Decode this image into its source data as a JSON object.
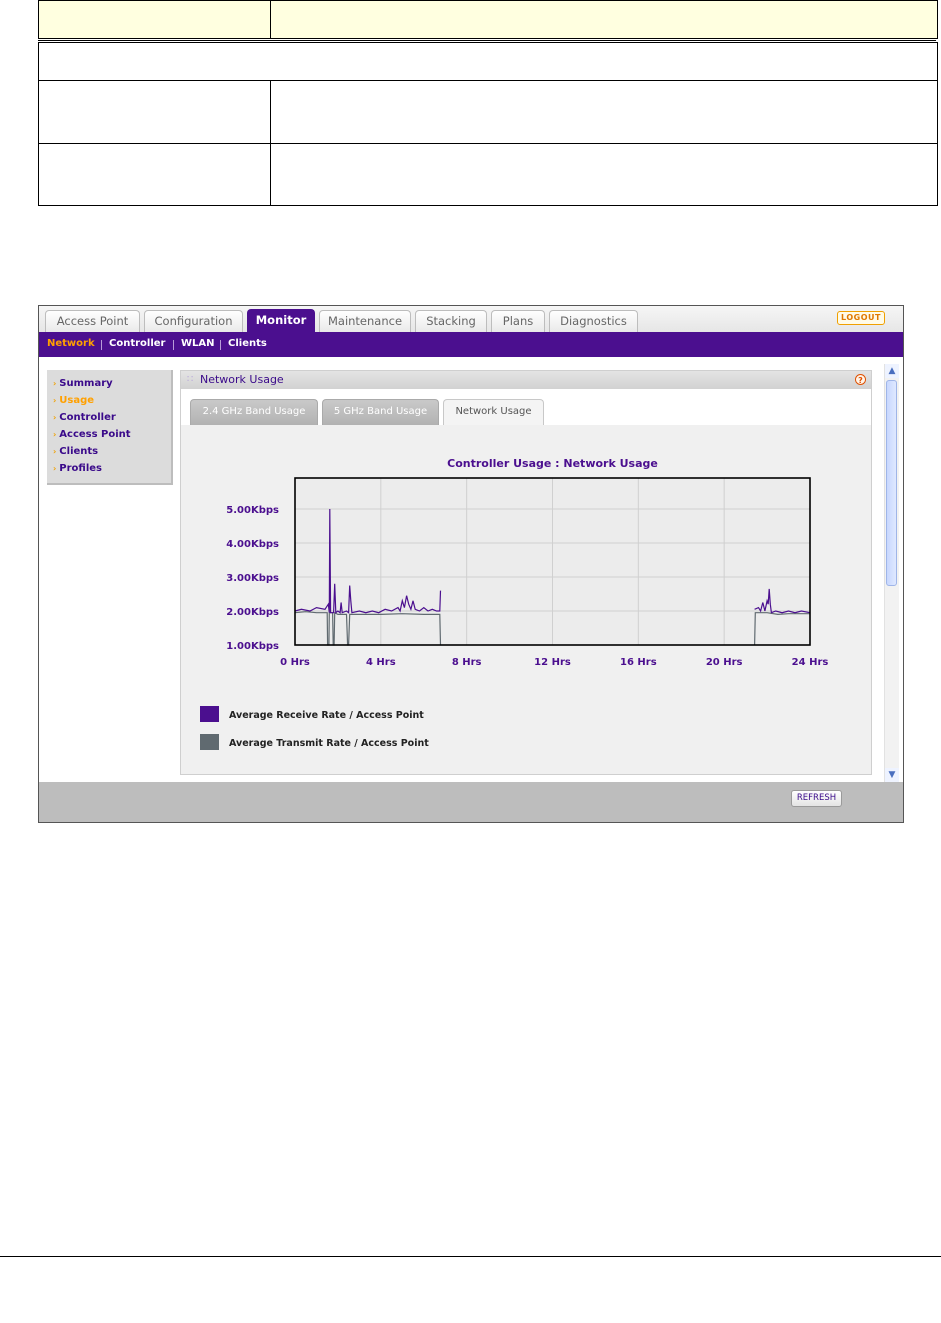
{
  "app": {
    "main_tabs": [
      {
        "label": "Access Point",
        "active": false
      },
      {
        "label": "Configuration",
        "active": false
      },
      {
        "label": "Monitor",
        "active": true
      },
      {
        "label": "Maintenance",
        "active": false
      },
      {
        "label": "Stacking",
        "active": false
      },
      {
        "label": "Plans",
        "active": false
      },
      {
        "label": "Diagnostics",
        "active": false
      }
    ],
    "logout_label": "LOGOUT",
    "sub_nav": [
      {
        "label": "Network",
        "active": true
      },
      {
        "label": "Controller",
        "active": false
      },
      {
        "label": "WLAN",
        "active": false
      },
      {
        "label": "Clients",
        "active": false
      }
    ],
    "left_menu": [
      {
        "label": "Summary",
        "active": false
      },
      {
        "label": "Usage",
        "active": true
      },
      {
        "label": "Controller",
        "active": false
      },
      {
        "label": "Access Point",
        "active": false
      },
      {
        "label": "Clients",
        "active": false
      },
      {
        "label": "Profiles",
        "active": false
      }
    ],
    "panel_title": "Network Usage",
    "usage_tabs": [
      {
        "label": "2.4 GHz Band Usage",
        "active": false
      },
      {
        "label": "5 GHz Band Usage",
        "active": false
      },
      {
        "label": "Network Usage",
        "active": true
      }
    ],
    "refresh_label": "REFRESH",
    "colors": {
      "brand_purple": "#4b0f8f",
      "accent_orange": "#ffa000"
    }
  },
  "chart_data": {
    "type": "line",
    "title": "Controller Usage : Network Usage",
    "y_tick_labels": [
      "5.00Kbps",
      "4.00Kbps",
      "3.00Kbps",
      "2.00Kbps",
      "1.00Kbps"
    ],
    "y_ticks": [
      5,
      4,
      3,
      2,
      1
    ],
    "x_tick_labels": [
      "0 Hrs",
      "4 Hrs",
      "8 Hrs",
      "12 Hrs",
      "16 Hrs",
      "20 Hrs",
      "24 Hrs"
    ],
    "x_ticks": [
      0,
      4,
      8,
      12,
      16,
      20,
      24
    ],
    "xlim": [
      0,
      24
    ],
    "ylim": [
      1,
      5
    ],
    "grid": true,
    "legend_position": "bottom-left",
    "series": [
      {
        "name": "Average Receive Rate / Access Point",
        "color": "#4b0f8f",
        "points": [
          [
            0,
            2.0
          ],
          [
            0.3,
            2.05
          ],
          [
            0.7,
            2.0
          ],
          [
            1.0,
            2.1
          ],
          [
            1.4,
            2.05
          ],
          [
            1.55,
            2.2
          ],
          [
            1.6,
            1.95
          ],
          [
            1.62,
            5.0
          ],
          [
            1.66,
            1.95
          ],
          [
            1.8,
            1.95
          ],
          [
            1.85,
            2.8
          ],
          [
            1.9,
            1.95
          ],
          [
            2.0,
            2.0
          ],
          [
            2.1,
            1.95
          ],
          [
            2.15,
            2.25
          ],
          [
            2.2,
            1.95
          ],
          [
            2.4,
            2.0
          ],
          [
            2.5,
            1.95
          ],
          [
            2.55,
            2.75
          ],
          [
            2.6,
            2.3
          ],
          [
            2.65,
            1.95
          ],
          [
            3.0,
            2.0
          ],
          [
            3.3,
            1.95
          ],
          [
            3.6,
            2.0
          ],
          [
            3.9,
            1.95
          ],
          [
            4.2,
            2.05
          ],
          [
            4.5,
            2.0
          ],
          [
            4.8,
            2.1
          ],
          [
            4.9,
            2.0
          ],
          [
            5.0,
            2.3
          ],
          [
            5.1,
            2.1
          ],
          [
            5.2,
            2.45
          ],
          [
            5.3,
            2.2
          ],
          [
            5.4,
            2.05
          ],
          [
            5.5,
            2.3
          ],
          [
            5.6,
            2.05
          ],
          [
            5.8,
            2.0
          ],
          [
            6.0,
            2.1
          ],
          [
            6.2,
            2.0
          ],
          [
            6.4,
            2.05
          ],
          [
            6.6,
            2.0
          ],
          [
            6.75,
            2.0
          ],
          [
            6.78,
            2.6
          ],
          [
            6.8,
            null
          ],
          [
            21.4,
            null
          ],
          [
            21.42,
            2.05
          ],
          [
            21.6,
            2.1
          ],
          [
            21.7,
            2.0
          ],
          [
            21.8,
            2.25
          ],
          [
            21.9,
            2.0
          ],
          [
            22.0,
            2.3
          ],
          [
            22.05,
            2.2
          ],
          [
            22.1,
            2.65
          ],
          [
            22.15,
            2.2
          ],
          [
            22.2,
            1.95
          ],
          [
            22.4,
            2.0
          ],
          [
            22.7,
            1.95
          ],
          [
            23.0,
            2.0
          ],
          [
            23.3,
            1.95
          ],
          [
            23.6,
            2.0
          ],
          [
            24,
            1.95
          ]
        ]
      },
      {
        "name": "Average Transmit Rate / Access Point",
        "color": "#606a70",
        "points": [
          [
            0,
            1.95
          ],
          [
            0.5,
            1.98
          ],
          [
            1.0,
            1.95
          ],
          [
            1.5,
            1.95
          ],
          [
            1.52,
            1.0
          ],
          [
            1.58,
            1.0
          ],
          [
            1.6,
            1.95
          ],
          [
            1.75,
            1.95
          ],
          [
            1.78,
            1.0
          ],
          [
            1.82,
            1.0
          ],
          [
            1.85,
            1.95
          ],
          [
            2.0,
            1.9
          ],
          [
            2.4,
            1.9
          ],
          [
            2.45,
            1.0
          ],
          [
            2.5,
            1.0
          ],
          [
            2.55,
            1.9
          ],
          [
            3.0,
            1.9
          ],
          [
            4.0,
            1.9
          ],
          [
            5.0,
            1.92
          ],
          [
            6.0,
            1.9
          ],
          [
            6.75,
            1.9
          ],
          [
            6.78,
            1.0
          ],
          [
            6.8,
            null
          ],
          [
            21.4,
            null
          ],
          [
            21.42,
            1.0
          ],
          [
            21.45,
            1.95
          ],
          [
            22.0,
            1.95
          ],
          [
            22.5,
            1.9
          ],
          [
            23.0,
            1.92
          ],
          [
            24,
            1.92
          ]
        ]
      }
    ]
  }
}
